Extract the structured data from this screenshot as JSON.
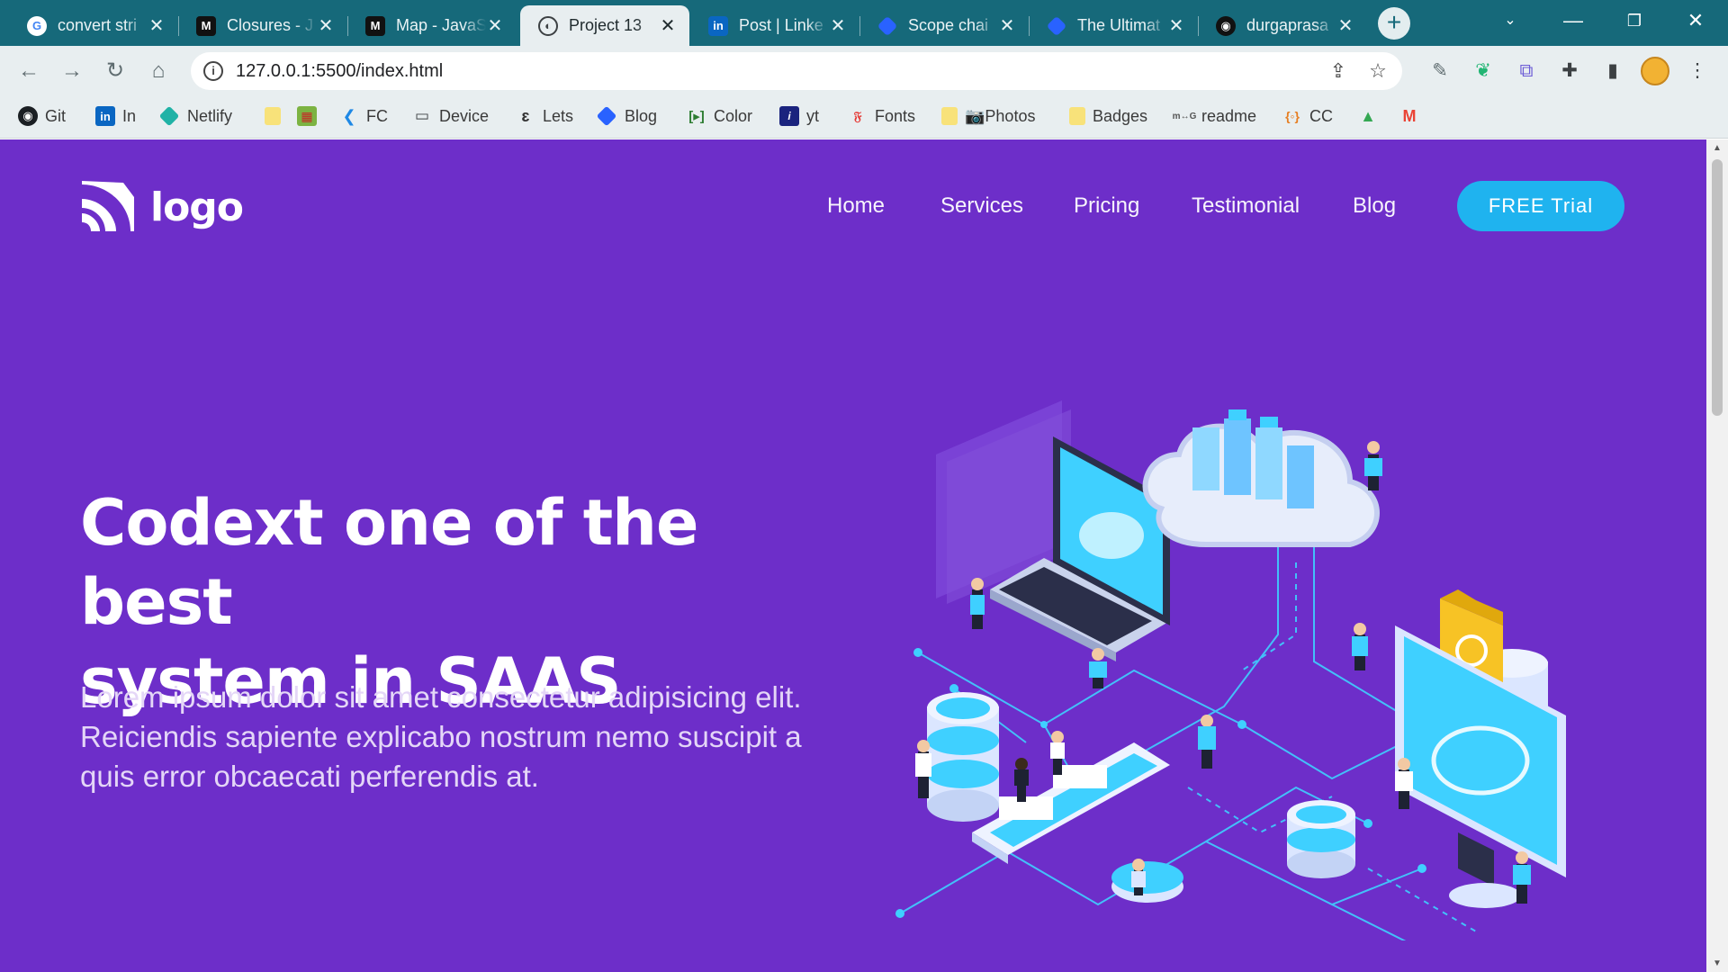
{
  "browser": {
    "tabs": [
      {
        "title": "convert stri",
        "icon": "google-icon"
      },
      {
        "title": "Closures - J",
        "icon": "mdn-icon"
      },
      {
        "title": "Map - JavaS",
        "icon": "mdn-icon"
      },
      {
        "title": "Project 13",
        "icon": "globe-icon",
        "active": true
      },
      {
        "title": "Post | Linke",
        "icon": "linkedin-icon"
      },
      {
        "title": "Scope chai",
        "icon": "blog-icon"
      },
      {
        "title": "The Ultimat",
        "icon": "blog-icon"
      },
      {
        "title": "durgaprasa",
        "icon": "github-icon"
      }
    ],
    "new_tab": "+",
    "url": "127.0.0.1:5500/index.html",
    "bookmarks": [
      {
        "label": "Git",
        "icon": "github-icon"
      },
      {
        "label": "In",
        "icon": "linkedin-icon"
      },
      {
        "label": "Netlify",
        "icon": "netlify-icon"
      },
      {
        "label": "",
        "icon": "folder-icon"
      },
      {
        "label": "",
        "icon": "app-icon"
      },
      {
        "label": "FC",
        "icon": "flutter-icon"
      },
      {
        "label": "Device",
        "icon": "device-icon"
      },
      {
        "label": "Lets",
        "icon": "lets-icon"
      },
      {
        "label": "Blog",
        "icon": "blog-icon"
      },
      {
        "label": "Color",
        "icon": "color-icon"
      },
      {
        "label": "yt",
        "icon": "yt-icon"
      },
      {
        "label": "Fonts",
        "icon": "fonts-icon"
      },
      {
        "label": "📷Photos",
        "icon": "folder-icon"
      },
      {
        "label": "Badges",
        "icon": "folder-icon"
      },
      {
        "label": "readme",
        "icon": "readme-icon"
      },
      {
        "label": "CC",
        "icon": "cc-icon"
      },
      {
        "label": "",
        "icon": "drive-icon"
      },
      {
        "label": "",
        "icon": "gmail-icon"
      }
    ]
  },
  "page": {
    "logo": "logo",
    "nav": [
      "Home",
      "Services",
      "Pricing",
      "Testimonial",
      "Blog"
    ],
    "cta": "FREE Trial",
    "hero": {
      "title_line1": "Codext one of the best",
      "title_line2": "system in SAAS",
      "text_line1": "Lorem ipsum dolor sit amet consectetur adipisicing elit.",
      "text_line2": "Reiciendis sapiente explicabo nostrum nemo suscipit a",
      "text_line3": "quis error obcaecati perferendis at."
    }
  },
  "colors": {
    "tab_strip": "#16697a",
    "page_bg": "#6d2ec9",
    "cta_bg": "#1fb3ef"
  }
}
